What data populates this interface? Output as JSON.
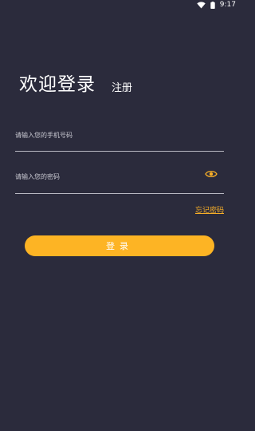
{
  "status_bar": {
    "time": "9:17",
    "wifi_icon": "wifi-icon",
    "battery_icon": "battery-icon"
  },
  "header": {
    "title": "欢迎登录",
    "register_label": "注册"
  },
  "form": {
    "phone": {
      "placeholder": "请输入您的手机号码",
      "value": ""
    },
    "password": {
      "placeholder": "请输入您的密码",
      "value": "",
      "toggle_icon": "eye-icon"
    },
    "forgot_label": "忘记密码"
  },
  "login_button": {
    "label": "登录"
  },
  "colors": {
    "background": "#2b2b3c",
    "accent": "#fdb424",
    "link": "#f6ae28",
    "divider": "#b8b8c2"
  }
}
